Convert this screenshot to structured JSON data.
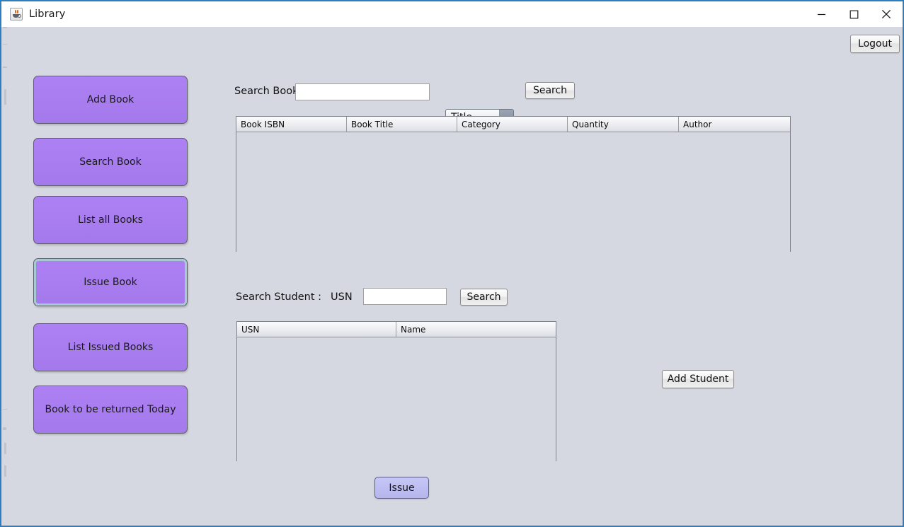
{
  "window": {
    "title": "Library",
    "icon": "java-coffee-cup-icon",
    "controls": {
      "minimize": "minimize-icon",
      "maximize": "maximize-icon",
      "close": "close-icon"
    }
  },
  "colors": {
    "window_border": "#2b7ec1",
    "client_background": "#d5d8e0",
    "sidebar_button": "#a97ef2",
    "issue_button": "#bfbff4",
    "titlebar_background": "#ffffff"
  },
  "toolbar": {
    "logout_label": "Logout"
  },
  "sidebar": {
    "items": [
      {
        "label": "Add Book",
        "focused": false
      },
      {
        "label": "Search Book",
        "focused": false
      },
      {
        "label": "List all Books",
        "focused": false
      },
      {
        "label": "Issue Book",
        "focused": true
      },
      {
        "label": "List Issued Books",
        "focused": false
      },
      {
        "label": "Book to be returned Today",
        "focused": false
      }
    ]
  },
  "book_search": {
    "label": "Search Book",
    "input_value": "",
    "input_placeholder": "",
    "filter_selected": "Title",
    "filter_options": [
      "Title"
    ],
    "search_button_label": "Search"
  },
  "book_table": {
    "columns": [
      "Book ISBN",
      "Book Title",
      "Category",
      "Quantity",
      "Author"
    ],
    "rows": []
  },
  "student_search": {
    "label": "Search Student :",
    "usn_label": "USN",
    "input_value": "",
    "input_placeholder": "",
    "search_button_label": "Search"
  },
  "student_table": {
    "columns": [
      "USN",
      "Name"
    ],
    "rows": []
  },
  "actions": {
    "add_student_label": "Add Student",
    "issue_label": "Issue"
  }
}
